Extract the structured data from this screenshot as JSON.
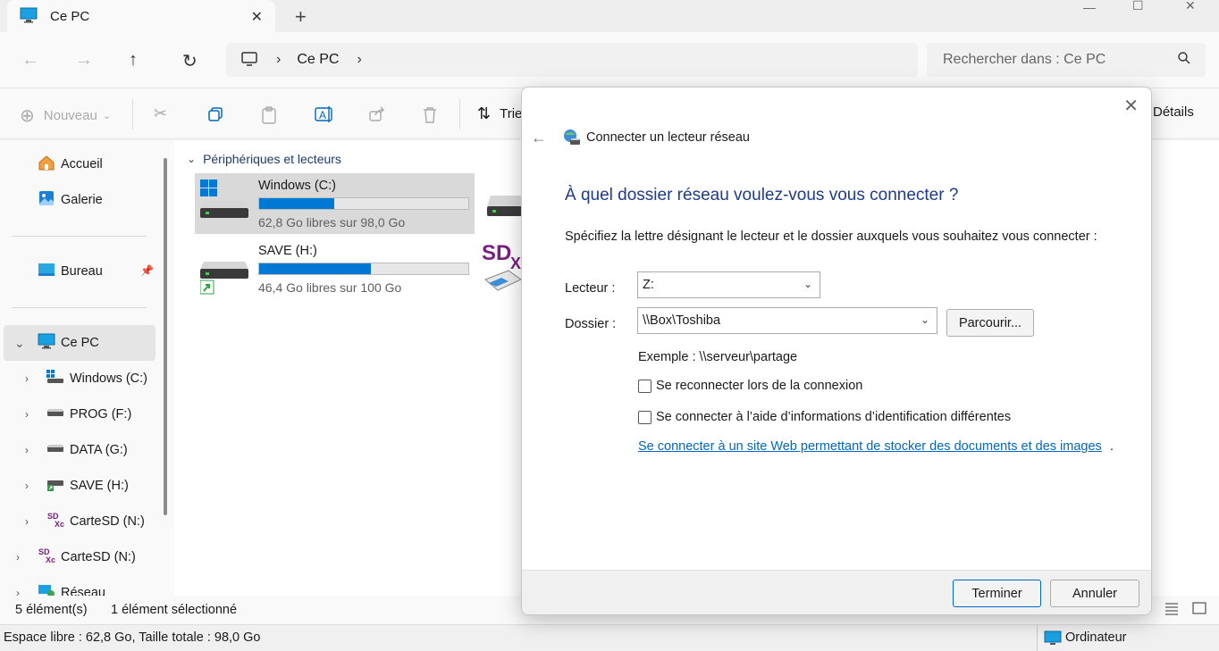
{
  "window": {
    "tab_title": "Ce PC"
  },
  "address": {
    "crumb": "Ce PC",
    "search_placeholder": "Rechercher dans : Ce PC"
  },
  "toolbar": {
    "new_label": "Nouveau",
    "sort_label": "Trier",
    "details_label": "Détails"
  },
  "sidebar": {
    "items": [
      {
        "label": "Accueil",
        "icon": "home-icon"
      },
      {
        "label": "Galerie",
        "icon": "gallery-icon"
      },
      {
        "label": "Bureau",
        "icon": "desktop-icon"
      },
      {
        "label": "Ce PC",
        "icon": "pc-icon"
      },
      {
        "label": "Windows (C:)",
        "icon": "windows-drive-icon"
      },
      {
        "label": "PROG (F:)",
        "icon": "drive-icon"
      },
      {
        "label": "DATA (G:)",
        "icon": "drive-icon"
      },
      {
        "label": "SAVE (H:)",
        "icon": "drive-icon"
      },
      {
        "label": "CarteSD (N:)",
        "icon": "sd-card-icon"
      },
      {
        "label": "CarteSD (N:)",
        "icon": "sd-card-icon"
      },
      {
        "label": "Réseau",
        "icon": "network-icon"
      }
    ]
  },
  "content": {
    "group_header": "Périphériques et lecteurs",
    "drives": [
      {
        "name": "Windows (C:)",
        "free": "62,8 Go libres sur 98,0 Go",
        "used_fraction": 0.36
      },
      {
        "name": "SAVE (H:)",
        "free": "46,4 Go libres sur 100 Go",
        "used_fraction": 0.536
      }
    ]
  },
  "status": {
    "count": "5 élément(s)",
    "selected": "1 élément sélectionné",
    "space": "Espace libre : 62,8 Go, Taille totale : 98,0 Go",
    "computer": "Ordinateur"
  },
  "dialog": {
    "title": "Connecter un lecteur réseau",
    "heading": "À quel dossier réseau voulez-vous vous connecter ?",
    "instructions": "Spécifiez la lettre désignant le lecteur et le dossier auxquels vous souhaitez vous connecter :",
    "drive_label": "Lecteur :",
    "drive_value": "Z:",
    "folder_label": "Dossier :",
    "folder_value": "\\\\Box\\Toshiba",
    "browse_label": "Parcourir...",
    "example": "Exemple : \\\\serveur\\partage",
    "reconnect_label": "Se reconnecter lors de la connexion",
    "reconnect_checked": false,
    "credentials_label": "Se connecter à l’aide d’informations d’identification différentes",
    "credentials_checked": false,
    "link_text": "Se connecter à un site Web permettant de stocker des documents et des images",
    "link_suffix": ".",
    "finish_label": "Terminer",
    "cancel_label": "Annuler"
  },
  "colors": {
    "accent": "#0078d4",
    "heading": "#1e3a8a",
    "link": "#0067c0"
  }
}
